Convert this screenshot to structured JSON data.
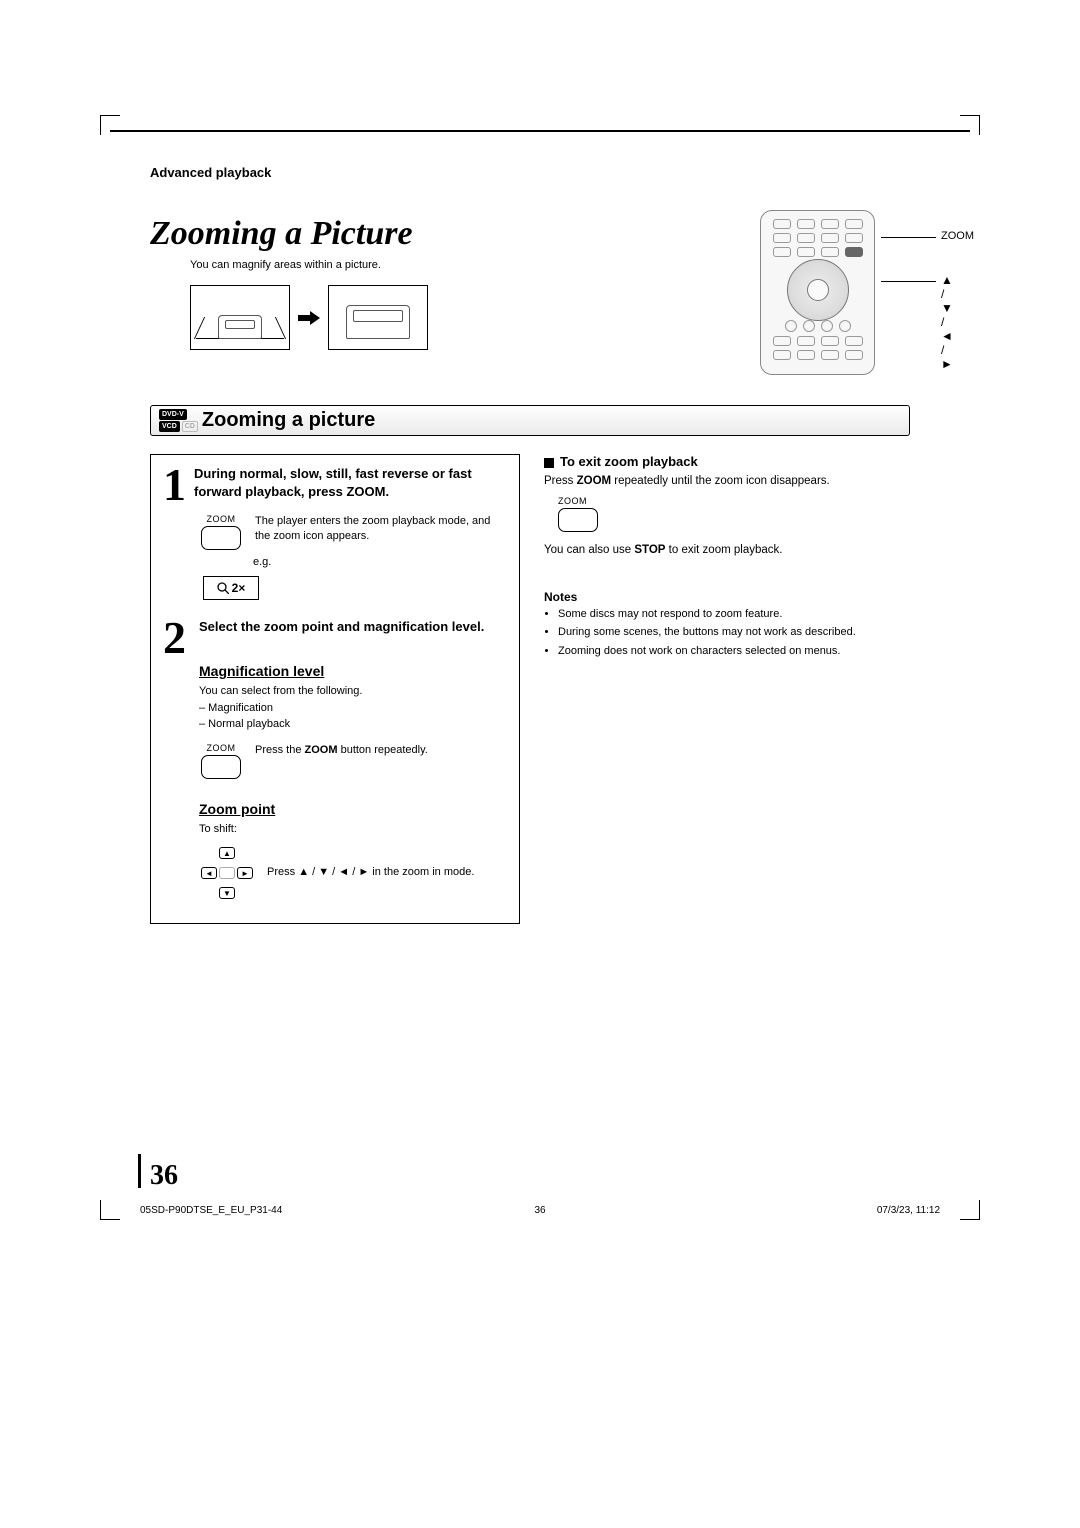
{
  "breadcrumb": "Advanced playback",
  "title_italic": "Zooming a Picture",
  "intro": "You can magnify areas within a picture.",
  "remote_labels": {
    "zoom": "ZOOM",
    "directions": "▲ / ▼ / ◄ / ►"
  },
  "section_bar": {
    "badges": {
      "dvdv": "DVD-V",
      "vcd": "VCD",
      "cd": "CD"
    },
    "title": "Zooming a picture"
  },
  "step1": {
    "num": "1",
    "head": "During normal, slow, still, fast reverse or fast forward playback, press ZOOM.",
    "btn_label": "ZOOM",
    "body": "The player enters the zoom playback mode, and the zoom icon appears.",
    "eg": "e.g.",
    "indicator": "2×"
  },
  "step2": {
    "num": "2",
    "head": "Select the zoom point and magnification level.",
    "mag_head": "Magnification level",
    "mag_body1": "You can select from the following.",
    "mag_body2": "– Magnification",
    "mag_body3": "– Normal playback",
    "zoom_btn_label": "ZOOM",
    "zoom_btn_text_a": "Press the ",
    "zoom_btn_text_b": "ZOOM",
    "zoom_btn_text_c": " button repeatedly.",
    "zp_head": "Zoom point",
    "zp_body": "To shift:",
    "zp_press_a": "Press ",
    "zp_press_b": "▲ / ▼ / ◄ / ►",
    "zp_press_c": " in the zoom in mode."
  },
  "right": {
    "exit_head": "To exit zoom playback",
    "exit_a": "Press ",
    "exit_b": "ZOOM",
    "exit_c": " repeatedly until the zoom icon disappears.",
    "btn_label": "ZOOM",
    "exit2_a": "You can also use ",
    "exit2_b": "STOP",
    "exit2_c": " to exit zoom playback.",
    "notes_head": "Notes",
    "notes": [
      "Some discs may not respond to zoom feature.",
      "During some scenes, the buttons may not work as described.",
      "Zooming does not work on characters selected on menus."
    ]
  },
  "page_number": "36",
  "footer": {
    "left": "05SD-P90DTSE_E_EU_P31-44",
    "center": "36",
    "right": "07/3/23, 11:12"
  }
}
